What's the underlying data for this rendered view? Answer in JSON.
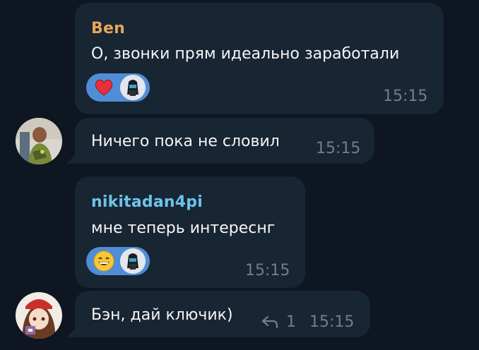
{
  "messages": [
    {
      "sender": "Ben",
      "sender_color": "#e4a65a",
      "text": "О, звонки прям идеально заработали",
      "time": "15:15",
      "reactions": [
        "heart-emoji",
        "user-avatar"
      ]
    },
    {
      "text": "Ничего пока не словил",
      "time": "15:15"
    },
    {
      "sender": "nikitadan4pi",
      "sender_color": "#6ec3ea",
      "text": "мне теперь интереснг",
      "time": "15:15",
      "reactions": [
        "grinning-emoji",
        "user-avatar"
      ]
    },
    {
      "text": "Бэн, дай ключик)",
      "time": "15:15",
      "replies_count": "1"
    }
  ],
  "colors": {
    "background": "#0e1621",
    "bubble": "#182533",
    "reaction": "#4f8ed6",
    "time": "#6d7f8f"
  }
}
